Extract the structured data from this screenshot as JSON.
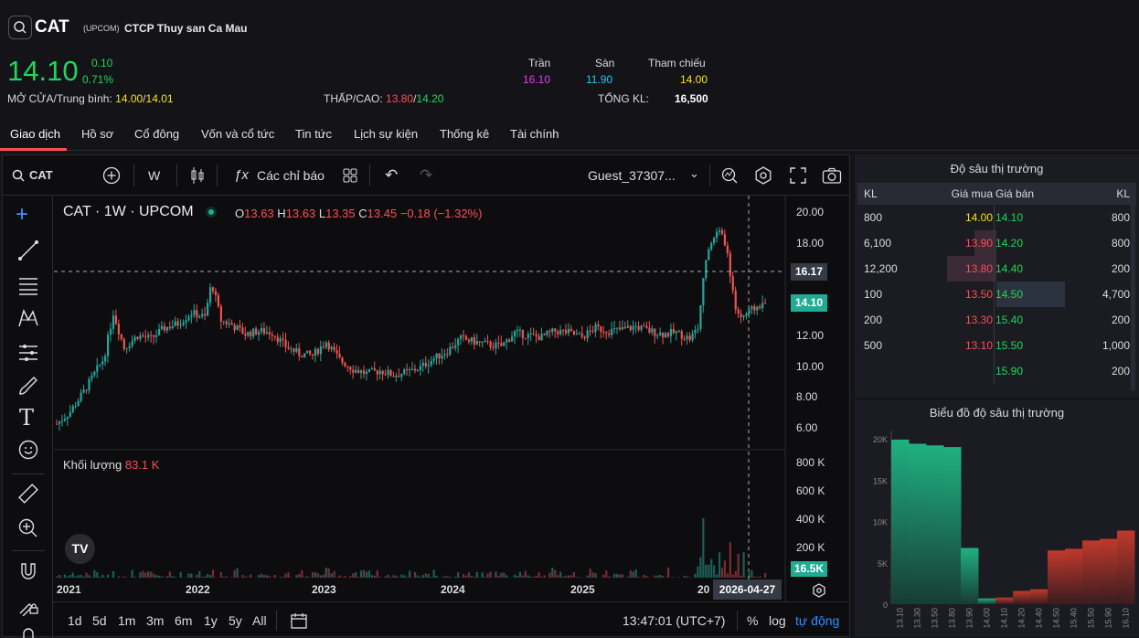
{
  "header": {
    "symbol": "CAT",
    "exchange": "(UPCOM)",
    "company": "CTCP Thuy san Ca Mau",
    "price": "14.10",
    "change": "0.10",
    "change_pct": "0.71%",
    "open_avg_label": "MỞ CỬA/Trung bình:",
    "open": "14.00",
    "avg": "14.01",
    "lowhigh_label": "THẤP/CAO:",
    "low": "13.80",
    "high": "14.20",
    "ceil_label": "Trần",
    "ceil": "16.10",
    "floor_label": "Sàn",
    "floor": "11.90",
    "ref_label": "Tham chiếu",
    "ref": "14.00",
    "vol_label": "TỔNG KL:",
    "vol": "16,500",
    "sep": "/"
  },
  "tabs": [
    "Giao dịch",
    "Hồ sơ",
    "Cổ đông",
    "Vốn và cổ tức",
    "Tin tức",
    "Lịch sự kiện",
    "Thống kê",
    "Tài chính"
  ],
  "toolbar": {
    "symbol": "CAT",
    "interval": "W",
    "indicators": "Các chỉ báo",
    "user": "Guest_37307..."
  },
  "legend": {
    "title": "CAT · 1W · UPCOM",
    "o_label": "O",
    "o": "13.63",
    "h_label": "H",
    "h": "13.63",
    "l_label": "L",
    "l": "13.35",
    "c_label": "C",
    "c": "13.45",
    "chg": "−0.18 (−1.32%)",
    "vol_label": "Khối lượng",
    "vol": "83.1 K"
  },
  "price_axis": [
    "20.00",
    "18.00",
    "16.00",
    "14.00",
    "12.00",
    "10.00",
    "8.00",
    "6.00"
  ],
  "price_markers": {
    "crosshair": "16.17",
    "last": "14.10"
  },
  "volume_axis": [
    "800 K",
    "600 K",
    "400 K",
    "200 K"
  ],
  "volume_marker": "16.5K",
  "time_axis": [
    "2021",
    "2022",
    "2023",
    "2024",
    "2025",
    "20"
  ],
  "crosshair_date": "2026-04-27",
  "ranges": [
    "1d",
    "5d",
    "1m",
    "3m",
    "6m",
    "1y",
    "5y",
    "All"
  ],
  "clock": "13:47:01 (UTC+7)",
  "scale_opts": {
    "pct": "%",
    "log": "log",
    "auto": "tự động"
  },
  "depth": {
    "title": "Độ sâu thị trường",
    "head": {
      "bid_vol": "KL",
      "bid": "Giá mua",
      "ask": "Giá bán",
      "ask_vol": "KL"
    },
    "rows": [
      {
        "bid_vol": "800",
        "bid": "14.00",
        "ask": "14.10",
        "ask_vol": "800"
      },
      {
        "bid_vol": "6,100",
        "bid": "13.90",
        "ask": "14.20",
        "ask_vol": "800"
      },
      {
        "bid_vol": "12,200",
        "bid": "13.80",
        "ask": "14.40",
        "ask_vol": "200"
      },
      {
        "bid_vol": "100",
        "bid": "13.50",
        "ask": "14.50",
        "ask_vol": "4,700"
      },
      {
        "bid_vol": "200",
        "bid": "13.30",
        "ask": "15.40",
        "ask_vol": "200"
      },
      {
        "bid_vol": "500",
        "bid": "13.10",
        "ask": "15.50",
        "ask_vol": "1,000"
      },
      {
        "bid_vol": "",
        "bid": "",
        "ask": "15.90",
        "ask_vol": "200"
      }
    ]
  },
  "depth_chart": {
    "title": "Biểu đồ độ sâu thị trường",
    "y_ticks": [
      "20K",
      "15K",
      "10K",
      "5K",
      "0"
    ],
    "x_ticks": [
      "13.10",
      "13.30",
      "13.50",
      "13.80",
      "13.90",
      "14.00",
      "14.10",
      "14.20",
      "14.40",
      "14.50",
      "15.40",
      "15.50",
      "15.90",
      "16.10"
    ]
  },
  "chart_data": {
    "type": "area",
    "categories": [
      "13.10",
      "13.30",
      "13.50",
      "13.80",
      "13.90",
      "14.00",
      "14.10",
      "14.20",
      "14.40",
      "14.50",
      "15.40",
      "15.50",
      "15.90",
      "16.10"
    ],
    "series": [
      {
        "values": [
          19900,
          19400,
          19200,
          19000,
          6800,
          700,
          0,
          0,
          0,
          0,
          0,
          0,
          0,
          0
        ]
      },
      {
        "values": [
          0,
          0,
          0,
          0,
          0,
          0,
          800,
          1600,
          1800,
          6500,
          6700,
          7700,
          7900,
          8900
        ]
      }
    ],
    "ylim": [
      0,
      21000
    ],
    "colors": {
      "bid": "#1fa876",
      "ask": "#c0392b"
    }
  }
}
